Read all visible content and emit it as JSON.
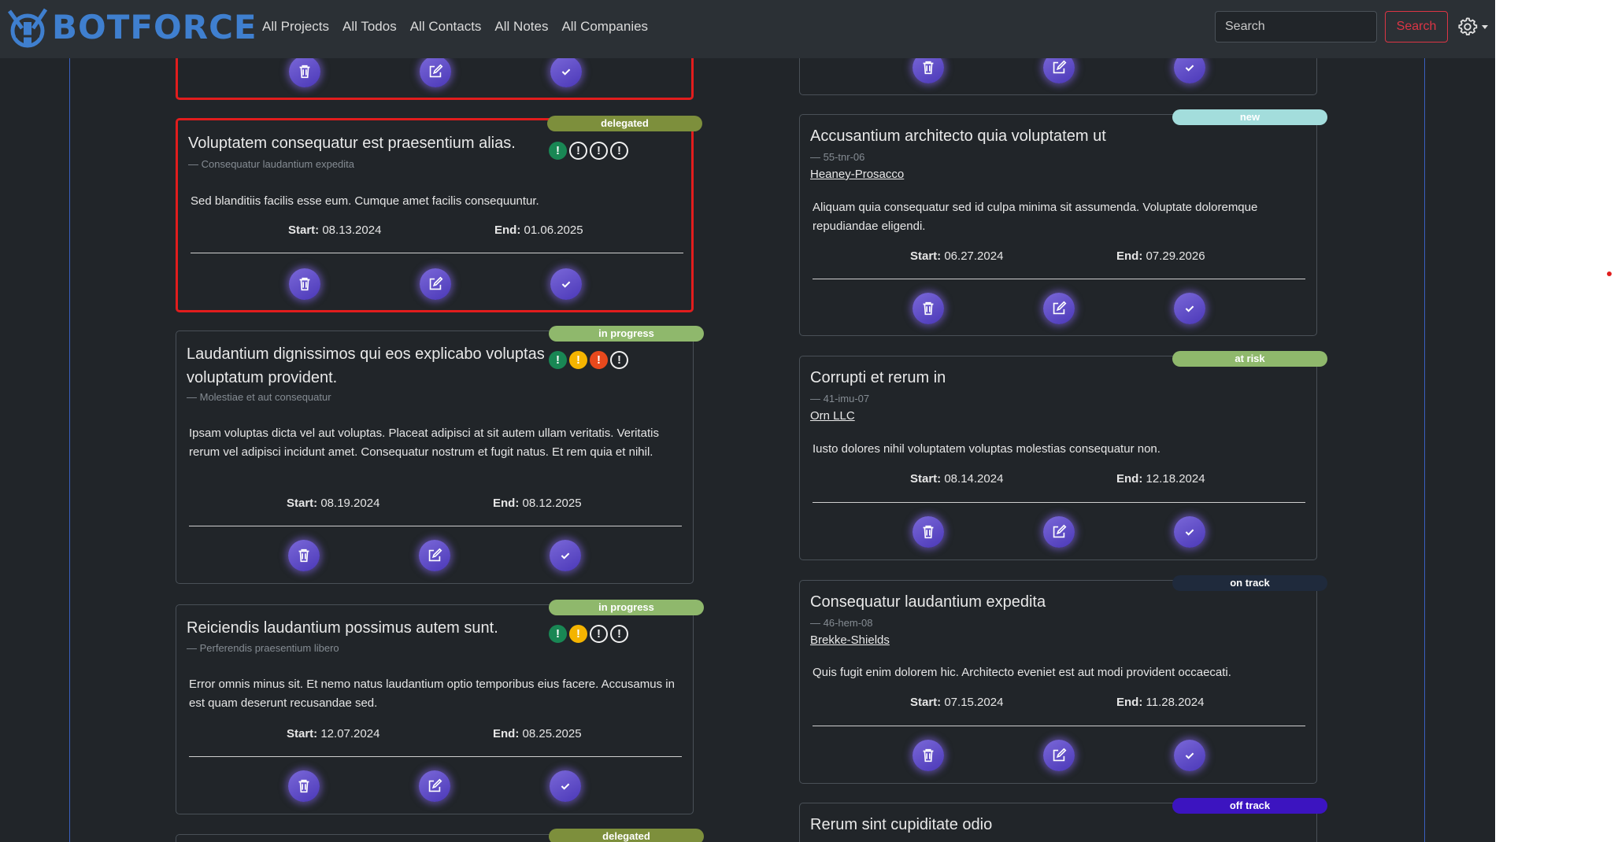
{
  "app": {
    "logo_text": "BOTFORCE",
    "nav": [
      "All Projects",
      "All Todos",
      "All Contacts",
      "All Notes",
      "All Companies"
    ],
    "search_placeholder": "Search",
    "search_button": "Search"
  },
  "labels": {
    "start": "Start:",
    "end": "End:"
  },
  "left_cards": [
    {
      "status": "",
      "title": "",
      "subtitle": "",
      "description": "",
      "start": "",
      "end": ""
    },
    {
      "status": "delegated",
      "title": "Voluptatem consequatur est praesentium alias.",
      "subtitle": "— Consequatur laudantium expedita",
      "description": "Sed blanditiis facilis esse eum. Cumque amet facilis consequuntur.",
      "start": "08.13.2024",
      "end": "01.06.2025",
      "priority": [
        "green",
        "empty",
        "empty",
        "empty"
      ]
    },
    {
      "status": "in progress",
      "title": "Laudantium dignissimos qui eos explicabo voluptas voluptatum provident.",
      "subtitle": "— Molestiae et aut consequatur",
      "description": "Ipsam voluptas dicta vel aut voluptas. Placeat adipisci at sit autem ullam veritatis. Veritatis rerum vel adipisci incidunt amet. Consequatur nostrum et fugit natus. Et rem quia et nihil.",
      "start": "08.19.2024",
      "end": "08.12.2025",
      "priority": [
        "green",
        "yellow",
        "red",
        "empty"
      ]
    },
    {
      "status": "in progress",
      "title": "Reiciendis laudantium possimus autem sunt.",
      "subtitle": "— Perferendis praesentium libero",
      "description": "Error omnis minus sit. Et nemo natus laudantium optio temporibus eius facere. Accusamus in est quam deserunt recusandae sed.",
      "start": "12.07.2024",
      "end": "08.25.2025",
      "priority": [
        "green",
        "yellow",
        "empty",
        "empty"
      ]
    },
    {
      "status": "delegated"
    }
  ],
  "right_cards": [
    {
      "status": ""
    },
    {
      "status": "new",
      "title": "Accusantium architecto quia voluptatem ut",
      "subtitle": "— 55-tnr-06",
      "company": "Heaney-Prosacco",
      "description": "Aliquam quia consequatur sed id culpa minima sit assumenda. Voluptate doloremque repudiandae eligendi.",
      "start": "06.27.2024",
      "end": "07.29.2026"
    },
    {
      "status": "at risk",
      "title": "Corrupti et rerum in",
      "subtitle": "— 41-imu-07",
      "company": "Orn LLC",
      "description": "Iusto dolores nihil voluptatem voluptas molestias consequatur non.",
      "start": "08.14.2024",
      "end": "12.18.2024"
    },
    {
      "status": "on track",
      "title": "Consequatur laudantium expedita",
      "subtitle": "— 46-hem-08",
      "company": "Brekke-Shields",
      "description": "Quis fugit enim dolorem hic. Architecto eveniet est aut modi provident occaecati.",
      "start": "07.15.2024",
      "end": "11.28.2024"
    },
    {
      "status": "off track",
      "title": "Rerum sint cupiditate odio"
    }
  ],
  "colors": {
    "delegated": "#7d8f3c",
    "in progress": "#8fb86c",
    "new": "#a3dddc",
    "at risk": "#8fb86c",
    "on track": "#1f2a3c",
    "off track": "#3c14c0",
    "selected_border": "#e11d1d"
  },
  "icons": {
    "delete": "trash-icon",
    "edit": "edit-icon",
    "complete": "check-icon",
    "settings": "gear-icon"
  }
}
